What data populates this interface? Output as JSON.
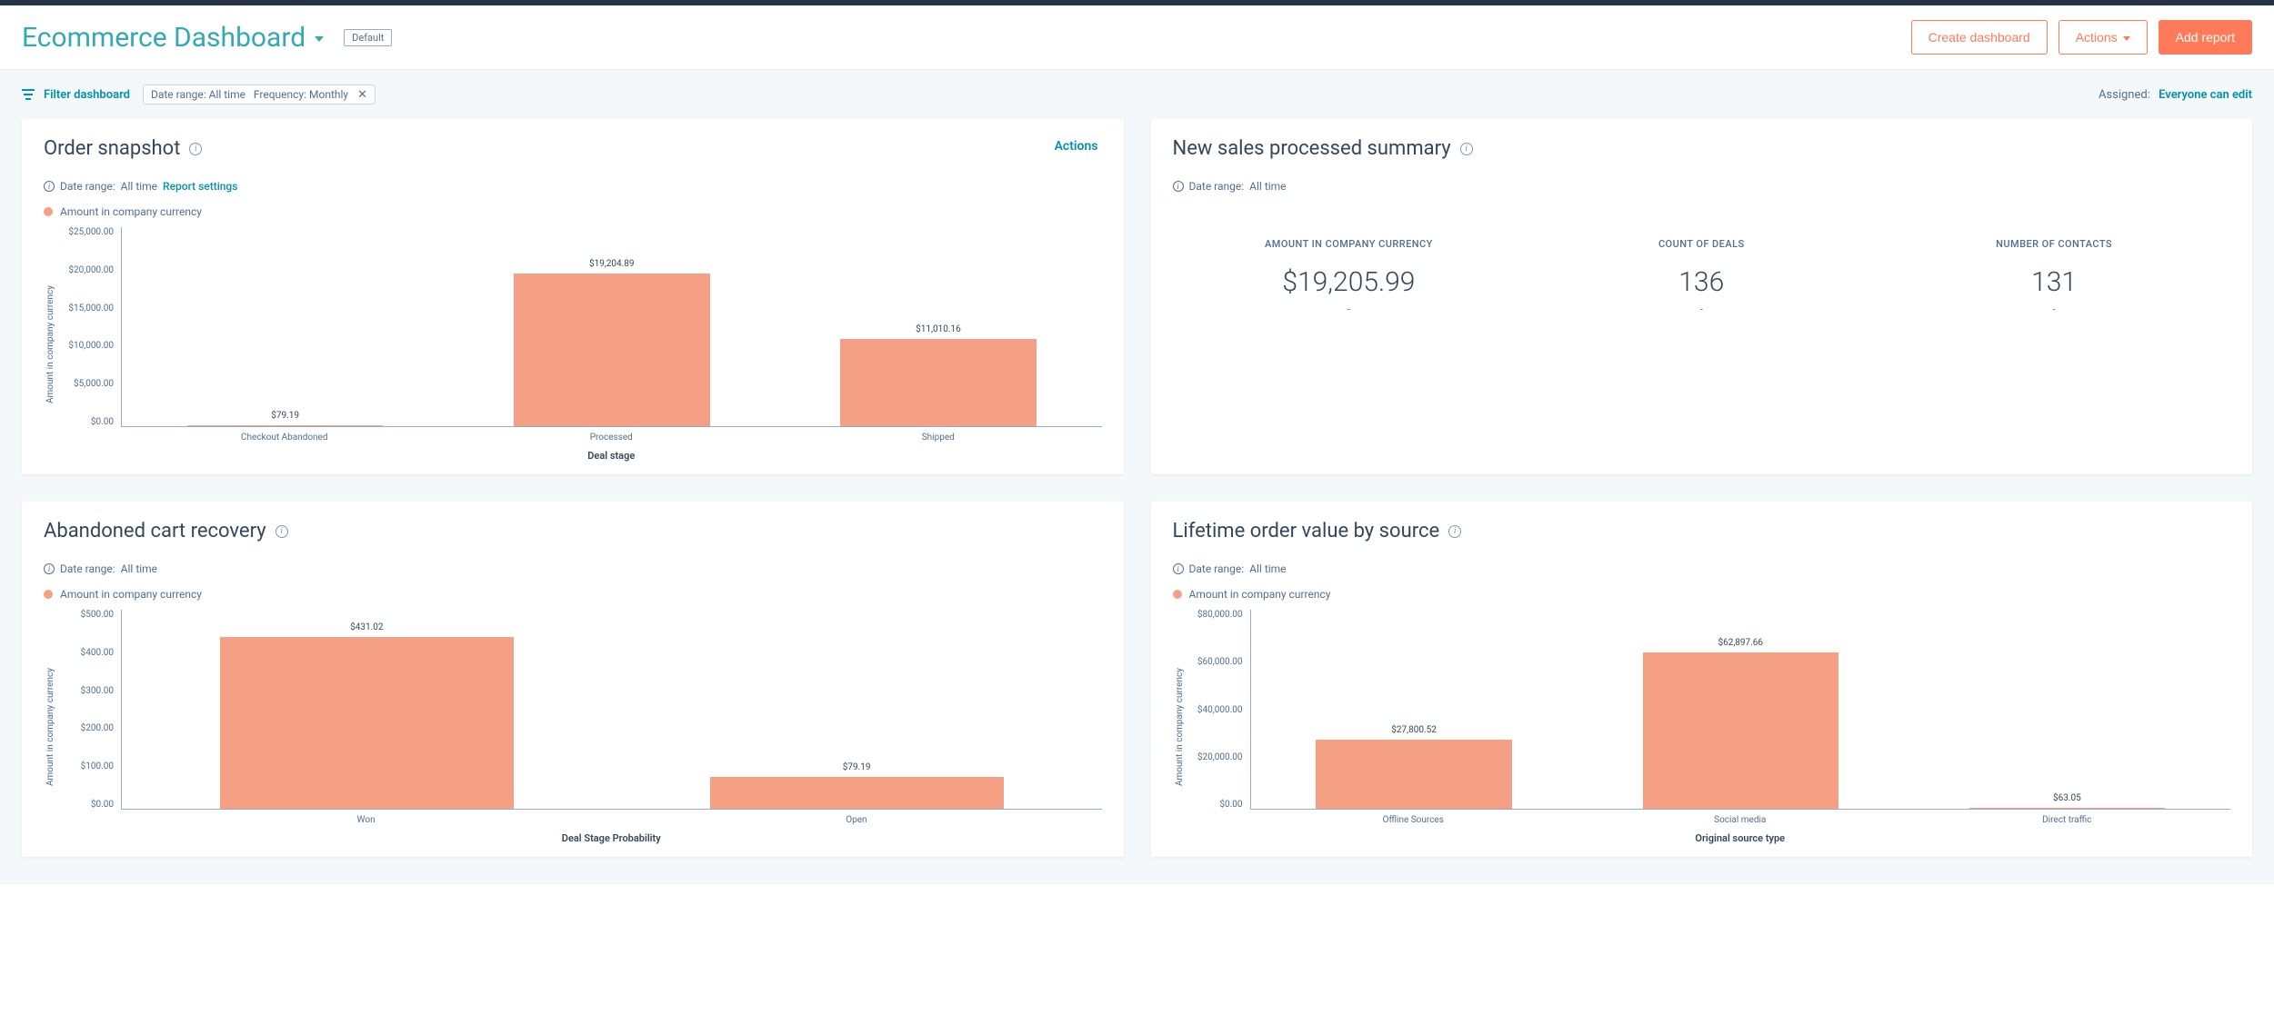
{
  "header": {
    "title": "Ecommerce Dashboard",
    "default_badge": "Default",
    "create_dashboard": "Create dashboard",
    "actions": "Actions",
    "add_report": "Add report"
  },
  "filter_bar": {
    "filter_label": "Filter dashboard",
    "chip_date_key": "Date range:",
    "chip_date_val": "All time",
    "chip_freq_key": "Frequency:",
    "chip_freq_val": "Monthly",
    "assigned_label": "Assigned:",
    "assigned_value": "Everyone can edit"
  },
  "panels": {
    "order_snapshot": {
      "title": "Order snapshot",
      "actions_label": "Actions",
      "meta_date_key": "Date range:",
      "meta_date_val": "All time",
      "report_settings": "Report settings",
      "legend": "Amount in company currency"
    },
    "new_sales": {
      "title": "New sales processed summary",
      "meta_date_key": "Date range:",
      "meta_date_val": "All time",
      "kpi1_label": "AMOUNT IN COMPANY CURRENCY",
      "kpi1_value": "$19,205.99",
      "kpi2_label": "COUNT OF DEALS",
      "kpi2_value": "136",
      "kpi3_label": "NUMBER OF CONTACTS",
      "kpi3_value": "131"
    },
    "abandoned": {
      "title": "Abandoned cart recovery",
      "meta_date_key": "Date range:",
      "meta_date_val": "All time",
      "legend": "Amount in company currency"
    },
    "lifetime": {
      "title": "Lifetime order value by source",
      "meta_date_key": "Date range:",
      "meta_date_val": "All time",
      "legend": "Amount in company currency"
    }
  },
  "chart_data": [
    {
      "id": "order_snapshot",
      "type": "bar",
      "title": "Order snapshot",
      "xlabel": "Deal stage",
      "ylabel": "Amount in company currency",
      "ylim": [
        0,
        25000
      ],
      "yticks": [
        "$25,000.00",
        "$20,000.00",
        "$15,000.00",
        "$10,000.00",
        "$5,000.00",
        "$0.00"
      ],
      "categories": [
        "Checkout Abandoned",
        "Processed",
        "Shipped"
      ],
      "values": [
        79.19,
        19204.89,
        11010.16
      ],
      "value_labels": [
        "$79.19",
        "$19,204.89",
        "$11,010.16"
      ]
    },
    {
      "id": "abandoned",
      "type": "bar",
      "title": "Abandoned cart recovery",
      "xlabel": "Deal Stage Probability",
      "ylabel": "Amount in company currency",
      "ylim": [
        0,
        500
      ],
      "yticks": [
        "$500.00",
        "$400.00",
        "$300.00",
        "$200.00",
        "$100.00",
        "$0.00"
      ],
      "categories": [
        "Won",
        "Open"
      ],
      "values": [
        431.02,
        79.19
      ],
      "value_labels": [
        "$431.02",
        "$79.19"
      ]
    },
    {
      "id": "lifetime",
      "type": "bar",
      "title": "Lifetime order value by source",
      "xlabel": "Original source type",
      "ylabel": "Amount in company currency",
      "ylim": [
        0,
        80000
      ],
      "yticks": [
        "$80,000.00",
        "$60,000.00",
        "$40,000.00",
        "$20,000.00",
        "$0.00"
      ],
      "categories": [
        "Offline Sources",
        "Social media",
        "Direct traffic"
      ],
      "values": [
        27800.52,
        62897.66,
        63.05
      ],
      "value_labels": [
        "$27,800.52",
        "$62,897.66",
        "$63.05"
      ]
    }
  ]
}
